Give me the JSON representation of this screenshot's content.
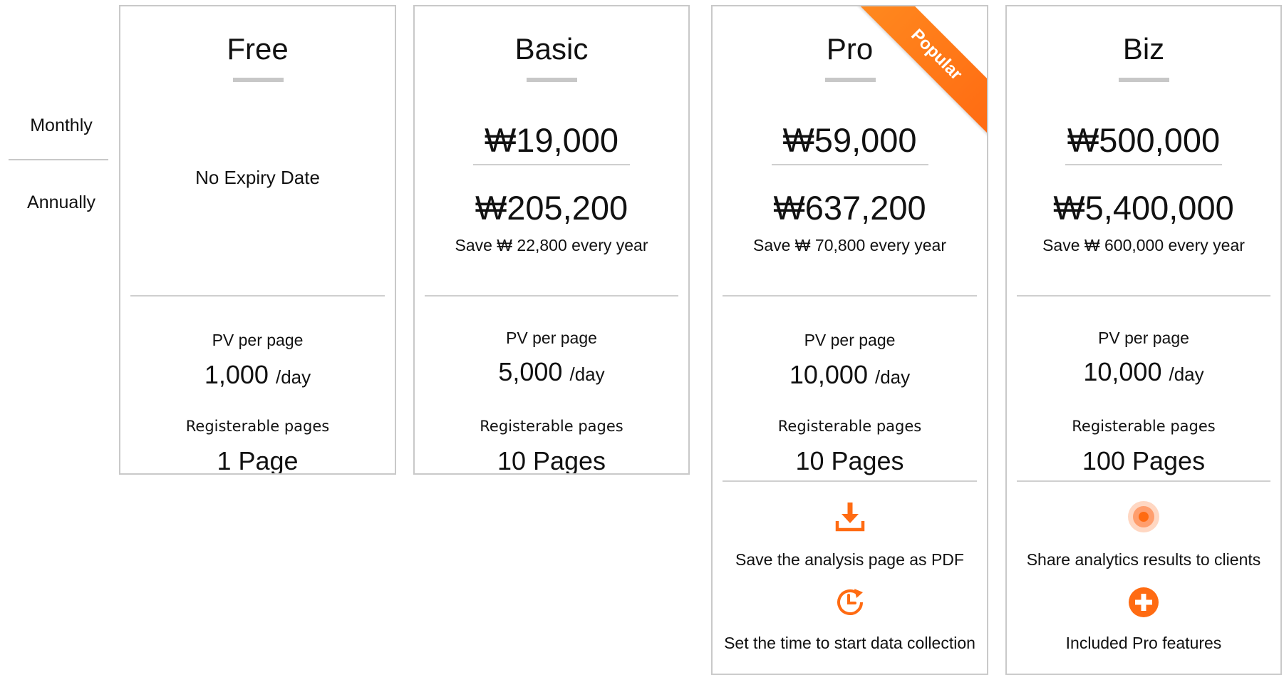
{
  "periods": {
    "monthly": "Monthly",
    "annually": "Annually"
  },
  "plans": {
    "free": {
      "name": "Free",
      "expiry": "No Expiry Date",
      "pv_label": "PV per page",
      "pv_value": "1,000",
      "pv_unit": "/day",
      "reg_label": "Registerable pages",
      "reg_value": "1 Page"
    },
    "basic": {
      "name": "Basic",
      "price_monthly": "₩19,000",
      "price_annual": "₩205,200",
      "save": "Save ₩ 22,800 every year",
      "pv_label": "PV per page",
      "pv_value": "5,000",
      "pv_unit": "/day",
      "reg_label": "Registerable pages",
      "reg_value": "10 Pages"
    },
    "pro": {
      "name": "Pro",
      "badge": "Popular",
      "price_monthly": "₩59,000",
      "price_annual": "₩637,200",
      "save": "Save ₩ 70,800 every year",
      "pv_label": "PV per page",
      "pv_value": "10,000",
      "pv_unit": "/day",
      "reg_label": "Registerable pages",
      "reg_value": "10 Pages",
      "features": [
        {
          "icon": "download-icon",
          "text": "Save the analysis page as PDF"
        },
        {
          "icon": "clock-refresh-icon",
          "text": "Set the time to start data collection"
        }
      ]
    },
    "biz": {
      "name": "Biz",
      "price_monthly": "₩500,000",
      "price_annual": "₩5,400,000",
      "save": "Save ₩ 600,000 every year",
      "pv_label": "PV per page",
      "pv_value": "10,000",
      "pv_unit": "/day",
      "reg_label": "Registerable pages",
      "reg_value": "100 Pages",
      "features": [
        {
          "icon": "broadcast-dot-icon",
          "text": "Share analytics results to clients"
        },
        {
          "icon": "plus-circle-icon",
          "text": "Included Pro features"
        }
      ]
    }
  },
  "colors": {
    "accent": "#ff6b12",
    "border": "#c9c9c9",
    "divider": "#cfcfcf"
  }
}
